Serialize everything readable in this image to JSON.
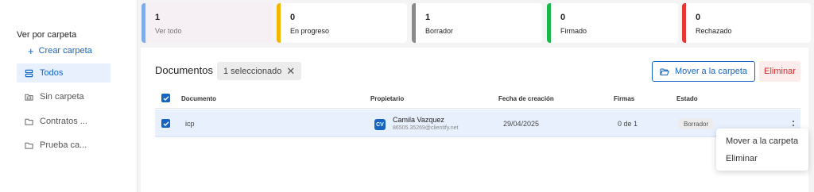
{
  "sidebar": {
    "title": "Ver por carpeta",
    "create_label": "Crear carpeta",
    "create_icon": "+",
    "items": [
      {
        "label": "Todos",
        "icon": "stack-icon",
        "active": true
      },
      {
        "label": "Sin carpeta",
        "icon": "folder-icon",
        "active": false
      },
      {
        "label": "Contratos ...",
        "icon": "folder-icon",
        "active": false
      },
      {
        "label": "Prueba ca...",
        "icon": "folder-icon",
        "active": false
      }
    ]
  },
  "stats": [
    {
      "count": "1",
      "label": "Ver todo",
      "color": "#82a9e8"
    },
    {
      "count": "0",
      "label": "En progreso",
      "color": "#f2b600"
    },
    {
      "count": "1",
      "label": "Borrador",
      "color": "#8a8a8a"
    },
    {
      "count": "0",
      "label": "Firmado",
      "color": "#18b84a"
    },
    {
      "count": "0",
      "label": "Rechazado",
      "color": "#e53935"
    }
  ],
  "documents": {
    "title": "Documentos",
    "selection_chip": "1 seleccionado",
    "move_button": "Mover a la carpeta",
    "delete_button": "Eliminar",
    "columns": {
      "document": "Documento",
      "owner": "Propietario",
      "created": "Fecha de creación",
      "signatures": "Firmas",
      "status": "Estado"
    },
    "rows": [
      {
        "name": "icp",
        "owner_initials": "CV",
        "owner_name": "Camila Vazquez",
        "owner_email": "86505.35269@clientify.net",
        "created": "29/04/2025",
        "signatures": "0 de 1",
        "status": "Borrador",
        "checked": true
      }
    ]
  },
  "context_menu": {
    "items": [
      "Mover a la carpeta",
      "Eliminar"
    ]
  },
  "colors": {
    "accent": "#1565c0",
    "danger": "#d32f2f",
    "selected_row": "#e8f0fe"
  }
}
